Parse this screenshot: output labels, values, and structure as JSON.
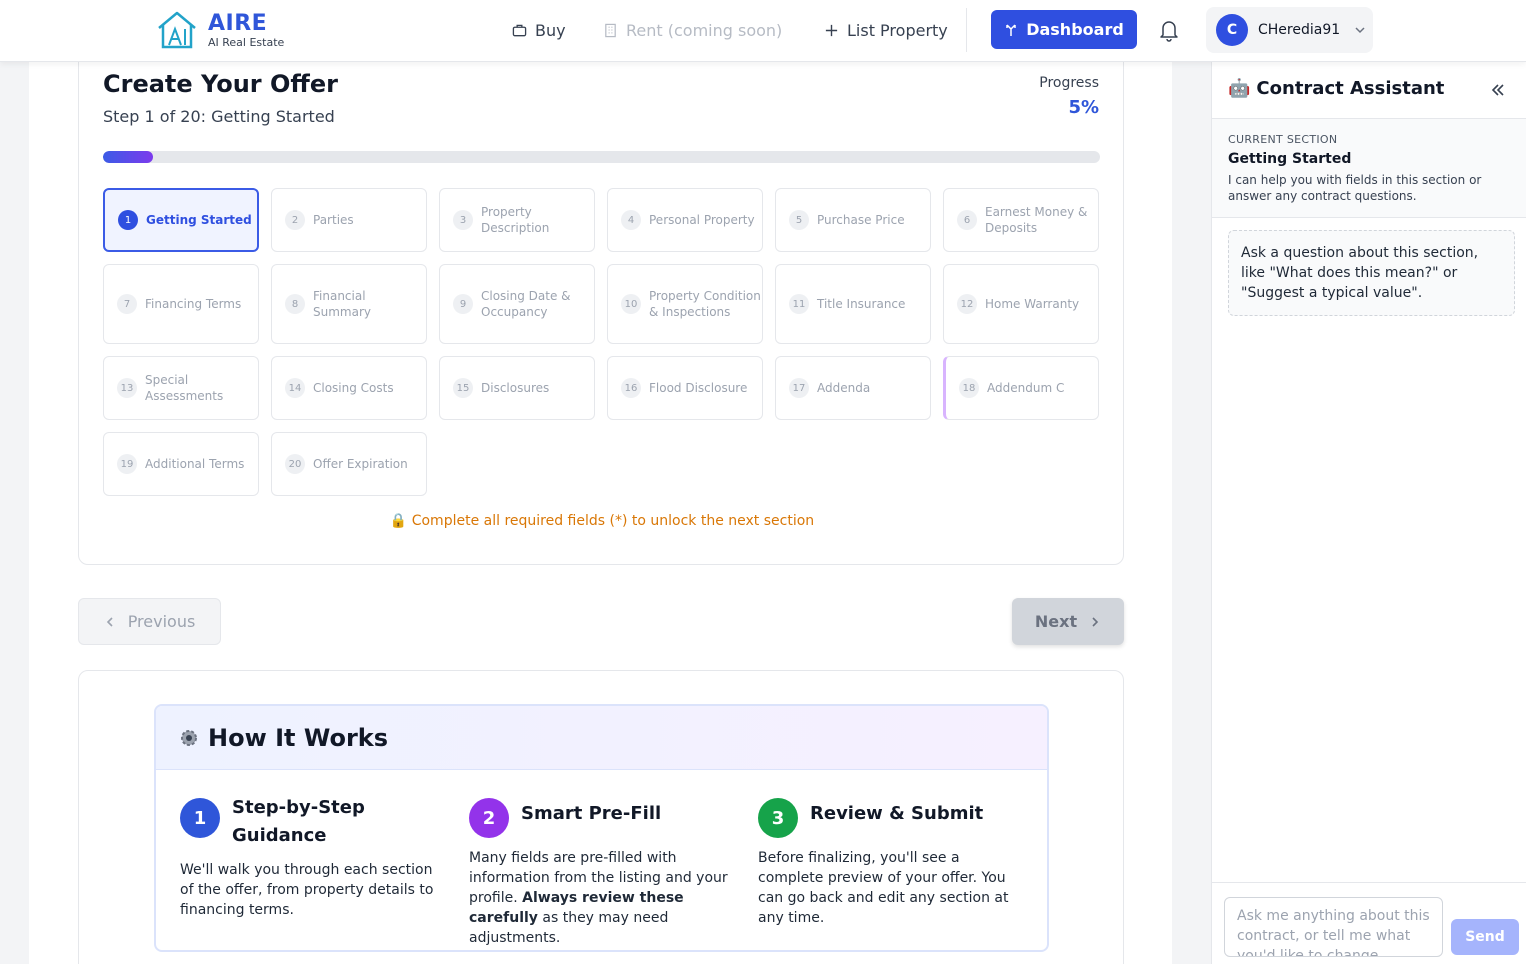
{
  "nav": {
    "brand": "AIRE",
    "brand_sub": "AI Real Estate",
    "buy": "Buy",
    "rent": "Rent (coming soon)",
    "list_property": "List Property",
    "dashboard": "Dashboard",
    "user_initial": "C",
    "username": "CHeredia91"
  },
  "offer": {
    "title": "Create Your Offer",
    "step_text": "Step 1 of 20: Getting Started",
    "progress_label": "Progress",
    "progress_value": "5%",
    "progress_fraction": 0.05,
    "unlock_note": "🔒 Complete all required fields (*) to unlock the next section",
    "steps": [
      {
        "num": "1",
        "label": "Getting Started"
      },
      {
        "num": "2",
        "label": "Parties"
      },
      {
        "num": "3",
        "label": "Property Description"
      },
      {
        "num": "4",
        "label": "Personal Property"
      },
      {
        "num": "5",
        "label": "Purchase Price"
      },
      {
        "num": "6",
        "label": "Earnest Money & Deposits"
      },
      {
        "num": "7",
        "label": "Financing Terms"
      },
      {
        "num": "8",
        "label": "Financial Summary"
      },
      {
        "num": "9",
        "label": "Closing Date & Occupancy"
      },
      {
        "num": "10",
        "label": "Property Condition & Inspections"
      },
      {
        "num": "11",
        "label": "Title Insurance"
      },
      {
        "num": "12",
        "label": "Home Warranty"
      },
      {
        "num": "13",
        "label": "Special Assessments"
      },
      {
        "num": "14",
        "label": "Closing Costs"
      },
      {
        "num": "15",
        "label": "Disclosures"
      },
      {
        "num": "16",
        "label": "Flood Disclosure"
      },
      {
        "num": "17",
        "label": "Addenda"
      },
      {
        "num": "18",
        "label": "Addendum C"
      },
      {
        "num": "19",
        "label": "Additional Terms"
      },
      {
        "num": "20",
        "label": "Offer Expiration"
      }
    ]
  },
  "buttons": {
    "previous": "Previous",
    "next": "Next"
  },
  "how": {
    "title": "How It Works",
    "items": [
      {
        "num": "1",
        "title": "Step-by-Step Guidance",
        "desc": "We'll walk you through each section of the offer, from property details to financing terms.",
        "color": "#2f56d9"
      },
      {
        "num": "2",
        "title": "Smart Pre-Fill",
        "desc_before": "Many fields are pre-filled with information from the listing and your profile. ",
        "desc_bold": "Always review these carefully",
        "desc_after": " as they may need adjustments.",
        "color": "#9333ea"
      },
      {
        "num": "3",
        "title": "Review & Submit",
        "desc": "Before finalizing, you'll see a complete preview of your offer. You can go back and edit any section at any time.",
        "color": "#16a34a"
      }
    ]
  },
  "assistant": {
    "icon": "🤖",
    "title": "Contract Assistant",
    "section_caption": "CURRENT SECTION",
    "section_name": "Getting Started",
    "section_help": "I can help you with fields in this section or answer any contract questions.",
    "hint": "Ask a question about this section, like \"What does this mean?\" or \"Suggest a typical value\".",
    "input_placeholder": "Ask me anything about this contract, or tell me what you'd like to change...",
    "send": "Send"
  },
  "colors": {
    "accent": "#2f4fe0",
    "warning": "#d97706"
  }
}
